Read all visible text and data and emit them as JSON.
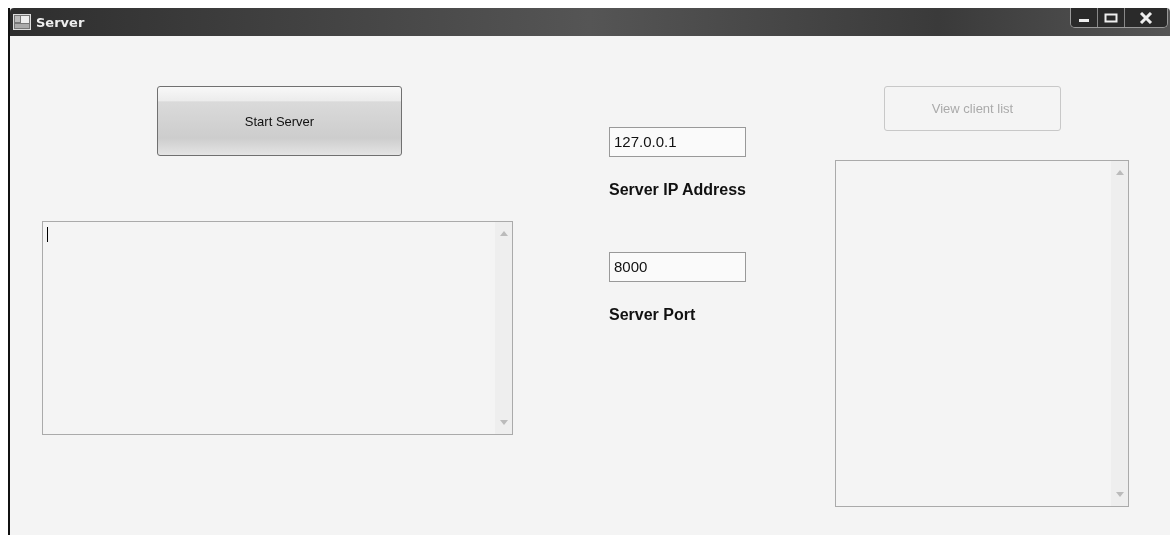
{
  "window": {
    "title": "Server"
  },
  "start_button": {
    "label": "Start Server",
    "disabled": false
  },
  "log_box": {
    "focused": true
  },
  "ip_field": {
    "value": "127.0.0.1"
  },
  "ip_label": "Server IP Address",
  "port_field": {
    "value": "8000"
  },
  "port_label": "Server Port",
  "view_button": {
    "label": "View client list",
    "disabled": true
  }
}
